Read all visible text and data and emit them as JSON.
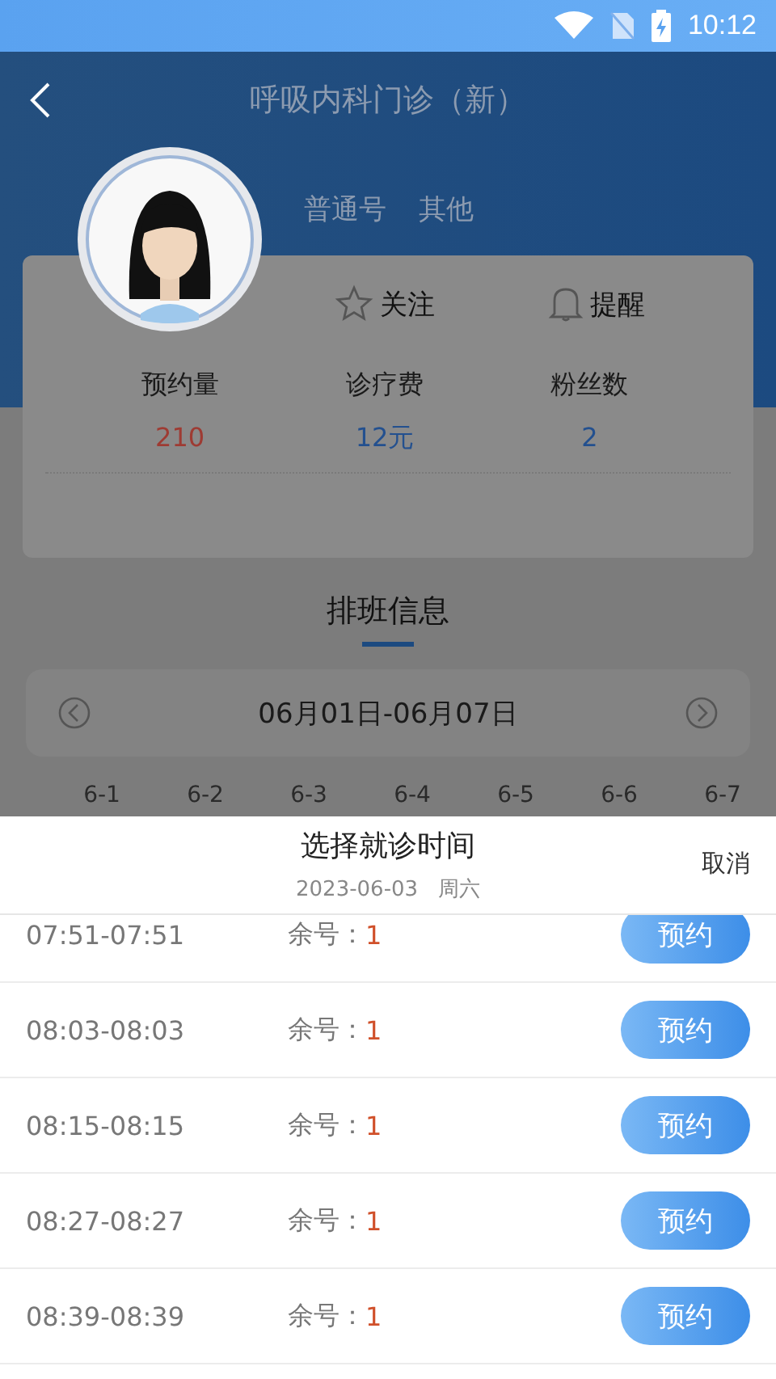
{
  "status_bar": {
    "time": "10:12"
  },
  "header": {
    "title": "呼吸内科门诊（新）"
  },
  "doctor": {
    "tags": [
      "普通号",
      "其他"
    ],
    "actions": [
      {
        "kind": "follow",
        "label": "关注"
      },
      {
        "kind": "remind",
        "label": "提醒"
      }
    ],
    "stats": [
      {
        "label": "预约量",
        "value": "210",
        "color": "#9e3b33"
      },
      {
        "label": "诊疗费",
        "value": "12元",
        "color": "#23508f"
      },
      {
        "label": "粉丝数",
        "value": "2",
        "color": "#23508f"
      }
    ]
  },
  "schedule": {
    "title": "排班信息",
    "week_range": "06月01日-06月07日",
    "days": [
      "6-1",
      "6-2",
      "6-3",
      "6-4",
      "6-5",
      "6-6",
      "6-7"
    ]
  },
  "sheet": {
    "title": "选择就诊时间",
    "date": "2023-06-03   周六",
    "cancel": "取消",
    "slots": [
      {
        "time": "07:51-07:51",
        "remaining_label": "余号：",
        "remaining": "1",
        "button": "预约"
      },
      {
        "time": "08:03-08:03",
        "remaining_label": "余号：",
        "remaining": "1",
        "button": "预约"
      },
      {
        "time": "08:15-08:15",
        "remaining_label": "余号：",
        "remaining": "1",
        "button": "预约"
      },
      {
        "time": "08:27-08:27",
        "remaining_label": "余号：",
        "remaining": "1",
        "button": "预约"
      },
      {
        "time": "08:39-08:39",
        "remaining_label": "余号：",
        "remaining": "1",
        "button": "预约"
      }
    ]
  }
}
